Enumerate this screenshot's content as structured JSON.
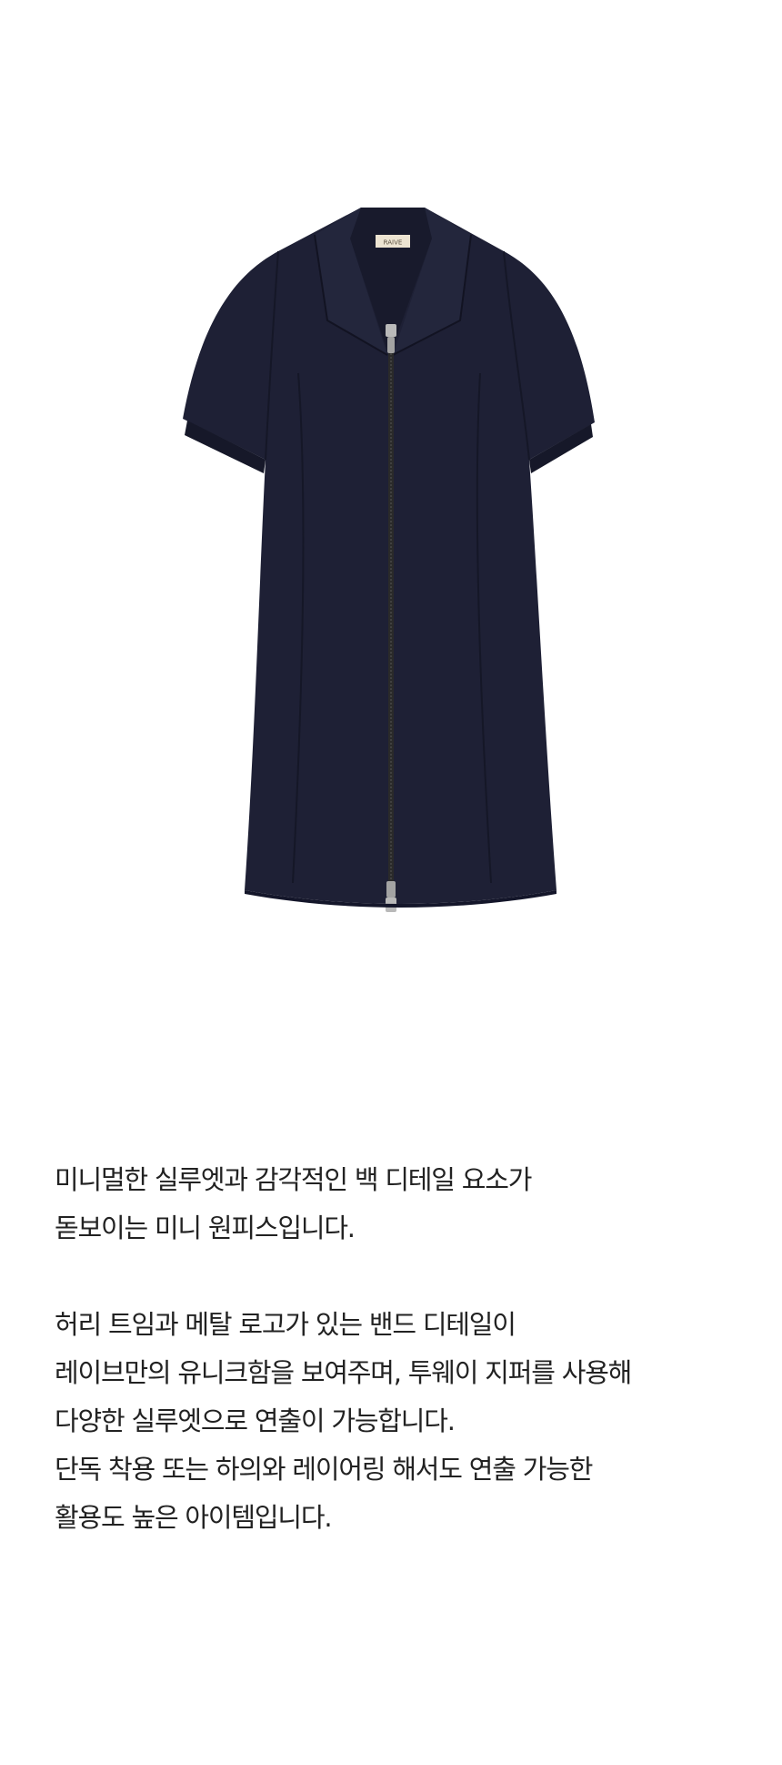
{
  "product": {
    "label_text": "RAIVE",
    "colors": {
      "dress": "#1e2035",
      "dress_shadow": "#161829",
      "zipper": "#2a2a2a",
      "zipper_pull": "#b9b9b9",
      "label": "#ede4d2"
    }
  },
  "description": {
    "paragraph1": [
      "미니멀한 실루엣과 감각적인 백 디테일 요소가",
      "돋보이는 미니 원피스입니다."
    ],
    "paragraph2": [
      "허리 트임과 메탈 로고가 있는 밴드 디테일이",
      "레이브만의 유니크함을 보여주며, 투웨이 지퍼를 사용해",
      "다양한 실루엣으로 연출이 가능합니다.",
      "단독 착용 또는 하의와 레이어링 해서도 연출 가능한",
      "활용도 높은 아이템입니다."
    ]
  }
}
